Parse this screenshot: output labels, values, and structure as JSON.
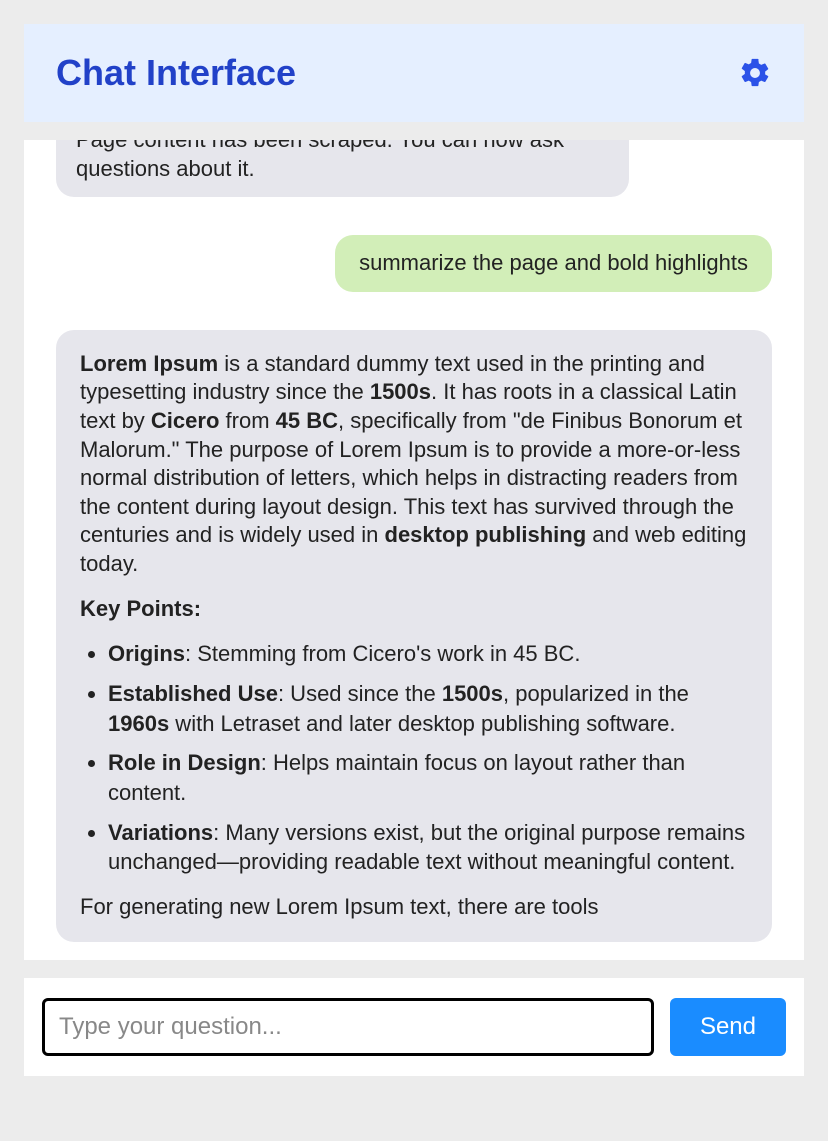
{
  "header": {
    "title": "Chat Interface"
  },
  "messages": {
    "system_text": "Page content has been scraped. You can now ask questions about it.",
    "user_text": "summarize the page and bold highlights",
    "assistant": {
      "intro_parts": {
        "b1": "Lorem Ipsum",
        "t1": " is a standard dummy text used in the printing and typesetting industry since the ",
        "b2": "1500s",
        "t2": ". It has roots in a classical Latin text by ",
        "b3": "Cicero",
        "t3": " from ",
        "b4": "45 BC",
        "t4": ", specifically from \"de Finibus Bonorum et Malorum.\" The purpose of Lorem Ipsum is to provide a more-or-less normal distribution of letters, which helps in distracting readers from the content during layout design. This text has survived through the centuries and is widely used in ",
        "b5": "desktop publishing",
        "t5": " and web editing today."
      },
      "key_points_heading": "Key Points:",
      "kp1": {
        "b1": "Origins",
        "t1": ": Stemming from Cicero's work in 45 BC."
      },
      "kp2": {
        "b1": "Established Use",
        "t1": ": Used since the ",
        "b2": "1500s",
        "t2": ", popularized in the ",
        "b3": "1960s",
        "t3": " with Letraset and later desktop publishing software."
      },
      "kp3": {
        "b1": "Role in Design",
        "t1": ": Helps maintain focus on layout rather than content."
      },
      "kp4": {
        "b1": "Variations",
        "t1": ": Many versions exist, but the original purpose remains unchanged—providing readable text without meaningful content."
      },
      "outro": "For generating new Lorem Ipsum text, there are tools"
    }
  },
  "input": {
    "placeholder": "Type your question...",
    "send_label": "Send"
  }
}
